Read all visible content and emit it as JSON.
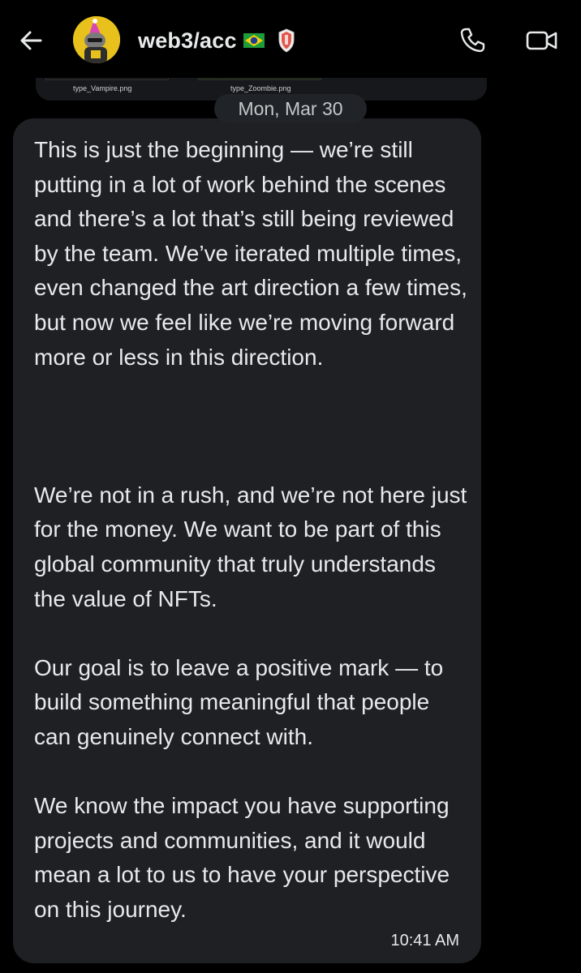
{
  "header": {
    "title": "web3/acc",
    "back_icon": "arrow-left-icon",
    "call_icon": "phone-icon",
    "video_icon": "video-camera-icon",
    "flag_icon": "brazil-flag-icon",
    "badge_icon": "shield-icon"
  },
  "previous_message": {
    "files": [
      "type_Vampire.png",
      "type_Zoombie.png"
    ]
  },
  "date_separator": "Mon, Mar 30",
  "message": {
    "paragraphs": [
      "This is just the beginning — we’re still putting in a lot of work behind the scenes and there’s a lot that’s still being reviewed by the team. We’ve iterated multiple times, even changed the art direction a few times, but now we feel like we’re moving forward more or less in this direction.",
      "We’re not in a rush, and we’re not here just for the money. We want to be part of this global community that truly understands the value of NFTs.",
      "Our goal is to leave a positive mark — to build something meaningful that people can genuinely connect with.",
      "We know the impact you have supporting projects and communities, and it would mean a lot to us to have your perspective on this journey."
    ],
    "time": "10:41 AM"
  },
  "colors": {
    "background": "#000000",
    "bubble": "#1e2024",
    "text": "#e7e9ea",
    "date_pill": "#202327",
    "avatar": "#e7c21d"
  }
}
